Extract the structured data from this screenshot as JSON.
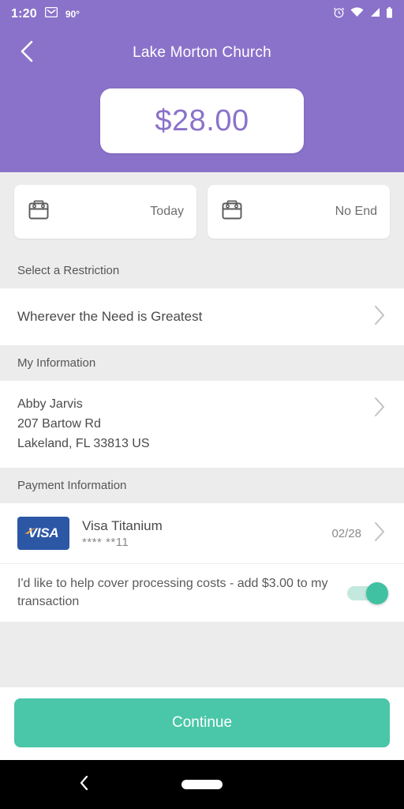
{
  "status_bar": {
    "time": "1:20",
    "temperature": "90°",
    "icons": [
      "gmail-icon",
      "alarm-icon",
      "wifi-icon",
      "cellular-icon",
      "battery-icon"
    ]
  },
  "header": {
    "title": "Lake Morton Church",
    "back_icon": "back-chevron-icon",
    "amount": "$28.00",
    "background_color": "#8a72ca",
    "amount_color": "#8a72ca"
  },
  "schedule": {
    "start": {
      "label": "Today",
      "icon": "calendar-icon"
    },
    "end": {
      "label": "No End",
      "icon": "calendar-icon"
    }
  },
  "restriction": {
    "section_label": "Select a Restriction",
    "value": "Wherever the Need is Greatest"
  },
  "my_information": {
    "section_label": "My Information",
    "name": "Abby Jarvis",
    "street": "207 Bartow Rd",
    "city_state_zip": "Lakeland, FL 33813 US"
  },
  "payment_information": {
    "section_label": "Payment Information",
    "brand": "VISA",
    "card_name": "Visa Titanium",
    "card_number": "**** **11",
    "expiry": "02/28"
  },
  "cover_costs": {
    "label": "I'd like to help cover processing costs - add $3.00 to my transaction",
    "enabled": true,
    "on_color": "#3fc1a2"
  },
  "footer": {
    "continue_label": "Continue",
    "continue_color": "#4ac6a8"
  },
  "nav_bar": {
    "back_icon": "nav-back-icon",
    "home_icon": "nav-home-pill-icon"
  }
}
